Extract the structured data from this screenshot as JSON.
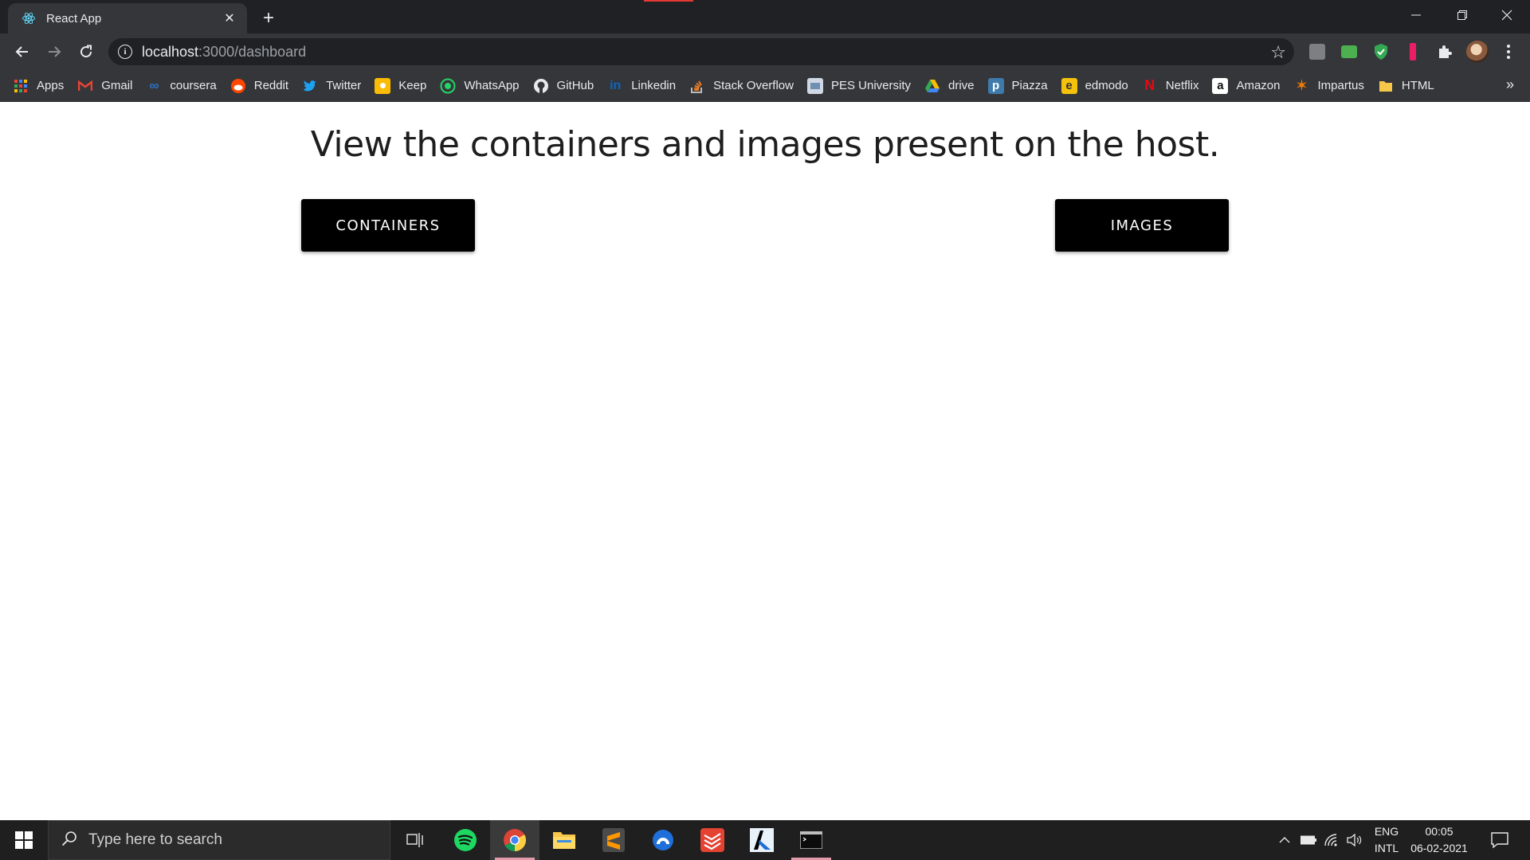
{
  "browser": {
    "tab": {
      "title": "React App"
    },
    "address": {
      "host": "localhost",
      "rest": ":3000/dashboard"
    },
    "bookmarks": [
      {
        "label": "Apps",
        "icon": "apps-grid-icon"
      },
      {
        "label": "Gmail",
        "icon": "gmail-icon"
      },
      {
        "label": "coursera",
        "icon": "coursera-icon"
      },
      {
        "label": "Reddit",
        "icon": "reddit-icon"
      },
      {
        "label": "Twitter",
        "icon": "twitter-icon"
      },
      {
        "label": "Keep",
        "icon": "keep-icon"
      },
      {
        "label": "WhatsApp",
        "icon": "whatsapp-icon"
      },
      {
        "label": "GitHub",
        "icon": "github-icon"
      },
      {
        "label": "Linkedin",
        "icon": "linkedin-icon"
      },
      {
        "label": "Stack Overflow",
        "icon": "stackoverflow-icon"
      },
      {
        "label": "PES University",
        "icon": "pes-icon"
      },
      {
        "label": "drive",
        "icon": "drive-icon"
      },
      {
        "label": "Piazza",
        "icon": "piazza-icon"
      },
      {
        "label": "edmodo",
        "icon": "edmodo-icon"
      },
      {
        "label": "Netflix",
        "icon": "netflix-icon"
      },
      {
        "label": "Amazon",
        "icon": "amazon-icon"
      },
      {
        "label": "Impartus",
        "icon": "impartus-icon"
      },
      {
        "label": "HTML",
        "icon": "folder-icon"
      }
    ],
    "bookmarks_more": "»"
  },
  "page": {
    "heading": "View the containers and images present on the host.",
    "containers_button": "CONTAINERS",
    "images_button": "IMAGES"
  },
  "taskbar": {
    "search_placeholder": "Type here to search",
    "lang_top": "ENG",
    "lang_bottom": "INTL",
    "time": "00:05",
    "date": "06-02-2021"
  },
  "colors": {
    "page_bg": "#ffffff",
    "button_bg": "#000000",
    "button_text": "#ffffff",
    "chrome_dark": "#202124",
    "chrome_toolbar": "#35363a"
  }
}
